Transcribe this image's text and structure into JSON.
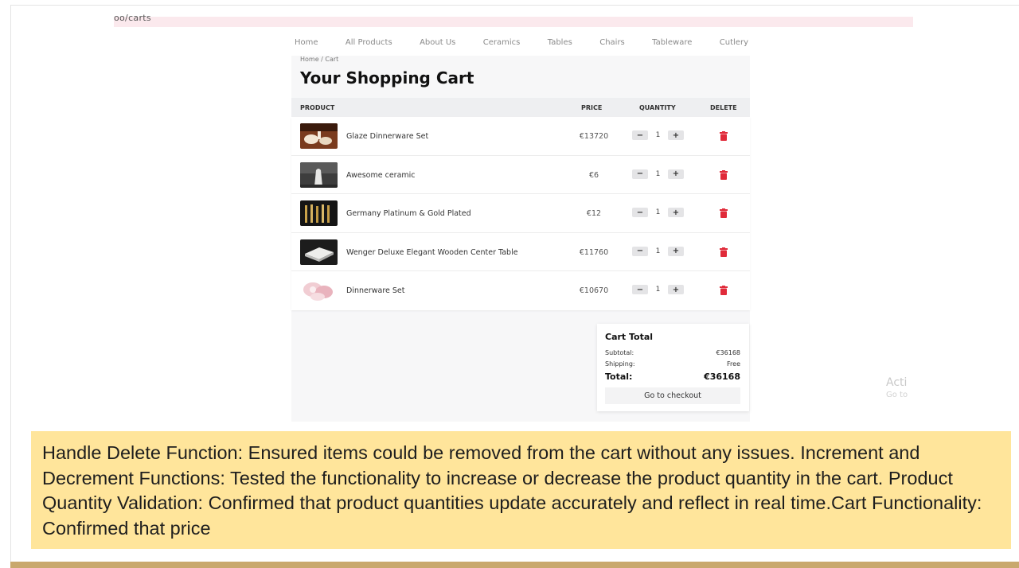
{
  "browser": {
    "url_fragment": "oo/carts"
  },
  "nav": [
    "Home",
    "All Products",
    "About Us",
    "Ceramics",
    "Tables",
    "Chairs",
    "Tableware",
    "Cutlery"
  ],
  "breadcrumb": "Home / Cart",
  "page_title": "Your Shopping Cart",
  "table": {
    "headers": {
      "product": "PRODUCT",
      "price": "PRICE",
      "quantity": "QUANTITY",
      "delete": "DELETE"
    },
    "rows": [
      {
        "name": "Glaze Dinnerware Set",
        "price": "€13720",
        "qty": "1"
      },
      {
        "name": "Awesome ceramic",
        "price": "€6",
        "qty": "1"
      },
      {
        "name": "Germany Platinum & Gold Plated",
        "price": "€12",
        "qty": "1"
      },
      {
        "name": "Wenger Deluxe Elegant Wooden Center Table",
        "price": "€11760",
        "qty": "1"
      },
      {
        "name": "Dinnerware Set",
        "price": "€10670",
        "qty": "1"
      }
    ],
    "minus": "−",
    "plus": "+"
  },
  "cart_total": {
    "title": "Cart Total",
    "subtotal_label": "Subtotal:",
    "subtotal_value": "€36168",
    "shipping_label": "Shipping:",
    "shipping_value": "Free",
    "total_label": "Total:",
    "total_value": "€36168",
    "checkout_label": "Go to checkout"
  },
  "watermark": {
    "line1": "Acti",
    "line2": "Go to"
  },
  "caption": "Handle Delete Function: Ensured items could be removed from the cart without any issues. Increment and Decrement Functions: Tested the functionality to increase or decrease the product quantity in the cart. Product Quantity Validation: Confirmed that product quantities update accurately and reflect in real time.Cart Functionality: Confirmed that price",
  "colors": {
    "delete_icon": "#e02b3a",
    "caption_bg": "#ffe59b",
    "bottom_bar": "#c9a86d",
    "url_strip": "#fbe9ed"
  }
}
